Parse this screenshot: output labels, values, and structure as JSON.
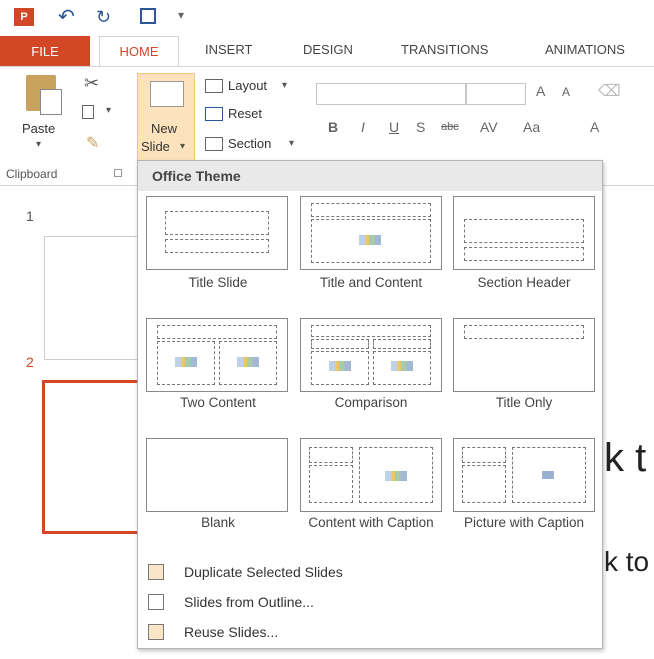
{
  "tabs": {
    "file": "FILE",
    "home": "HOME",
    "insert": "INSERT",
    "design": "DESIGN",
    "transitions": "TRANSITIONS",
    "animations": "ANIMATIONS"
  },
  "ribbon": {
    "paste": "Paste",
    "new_slide_1": "New",
    "new_slide_2": "Slide",
    "layout": "Layout",
    "reset": "Reset",
    "section": "Section",
    "clipboard_group": "Clipboard",
    "font_grow": "A",
    "font_shrink": "A",
    "case": "Aa",
    "color_a": "A"
  },
  "thumbnails": {
    "slide1": "1",
    "slide2": "2"
  },
  "slide_preview": {
    "text1": "k t",
    "text2": "k to"
  },
  "dropdown": {
    "header": "Office Theme",
    "layouts": [
      {
        "name": "Title Slide"
      },
      {
        "name": "Title and Content"
      },
      {
        "name": "Section Header"
      },
      {
        "name": "Two Content"
      },
      {
        "name": "Comparison"
      },
      {
        "name": "Title Only"
      },
      {
        "name": "Blank"
      },
      {
        "name": "Content with Caption"
      },
      {
        "name": "Picture with Caption"
      }
    ],
    "menu": {
      "duplicate": "Duplicate Selected Slides",
      "outline": "Slides from Outline...",
      "reuse": "Reuse Slides..."
    }
  },
  "colors": {
    "accent": "#d24726",
    "ribbon_bg": "#ffffff",
    "dropdown_header_bg": "#e9e9e9"
  }
}
